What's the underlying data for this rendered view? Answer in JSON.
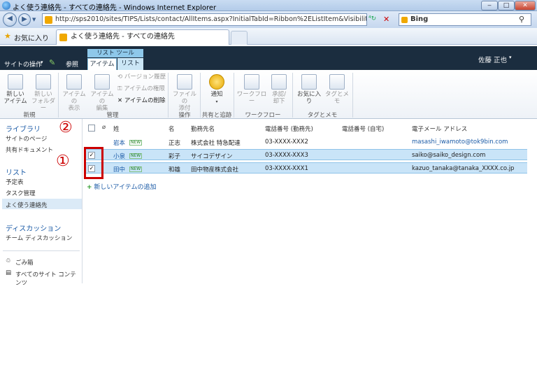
{
  "window": {
    "title": "よく使う連絡先 - すべての連絡先 - Windows Internet Explorer",
    "minimize": "‒",
    "maximize": "□",
    "close": "✕"
  },
  "address": {
    "url": "http://sps2010/sites/TIPS/Lists/contact/AllItems.aspx?InitialTabId=Ribbon%2EListItem&Visibility",
    "search_placeholder": "Bing"
  },
  "favorites": {
    "label": "お気に入り",
    "tab_title": "よく使う連絡先 - すべての連絡先"
  },
  "ribbon_header": {
    "site_actions": "サイトの操作",
    "browse": "参照",
    "tool_group": "リスト ツール",
    "tab_items": "アイテム",
    "tab_list": "リスト",
    "user": "佐藤 正也"
  },
  "ribbon": {
    "new_item": "新しい\nアイテム",
    "new_folder": "新しい\nフォルダー",
    "group_new": "新規",
    "view_item": "アイテムの\n表示",
    "edit_item": "アイテムの\n編集",
    "version_history": "バージョン履歴",
    "permissions": "アイテムの権限",
    "delete_item": "アイテムの削除",
    "group_manage": "管理",
    "attach": "ファイルの\n添付",
    "group_actions": "操作",
    "alert": "通知",
    "group_share": "共有と追跡",
    "workflow": "ワークフロー",
    "approve": "承認/\n却下",
    "group_workflow": "ワークフロー",
    "favorite": "お気に入り",
    "tag_memo": "タグとメモ",
    "group_tags": "タグとメモ"
  },
  "leftnav": {
    "libraries": "ライブラリ",
    "site_pages": "サイトのページ",
    "shared_docs": "共有ドキュメント",
    "lists": "リスト",
    "calendar": "予定表",
    "tasks": "タスク管理",
    "contacts": "よく使う連絡先",
    "discussions": "ディスカッション",
    "team_discussion": "チーム ディスカッション",
    "recycle": "ごみ箱",
    "all_content": "すべてのサイト コンテンツ"
  },
  "table": {
    "headers": {
      "last": "姓",
      "first": "名",
      "company": "勤務先名",
      "work_phone": "電話番号 (勤務先)",
      "home_phone": "電話番号 (自宅)",
      "email": "電子メール アドレス"
    },
    "new_badge": "NEW",
    "rows": [
      {
        "last": "岩本",
        "first": "正志",
        "company": "株式会社 特急配達",
        "work_phone": "03-XXXX-XXX2",
        "email": "masashi_iwamoto@tok9bin.com",
        "checked": false
      },
      {
        "last": "小泉",
        "first": "彩子",
        "company": "サイコデザイン",
        "work_phone": "03-XXXX-XXX3",
        "email": "saiko@saiko_design.com",
        "checked": true
      },
      {
        "last": "田中",
        "first": "和雄",
        "company": "田中物産株式会社",
        "work_phone": "03-XXXX-XXX1",
        "email": "kazuo_tanaka@tanaka_XXXX.co.jp",
        "checked": true
      }
    ],
    "add_new": "新しいアイテムの追加"
  },
  "annotations": {
    "one": "①",
    "two": "②"
  },
  "colors": {
    "selected_row": "#c9e4f8",
    "accent_red": "#cc0000",
    "ribbon_dark": "#1b2d3f"
  }
}
